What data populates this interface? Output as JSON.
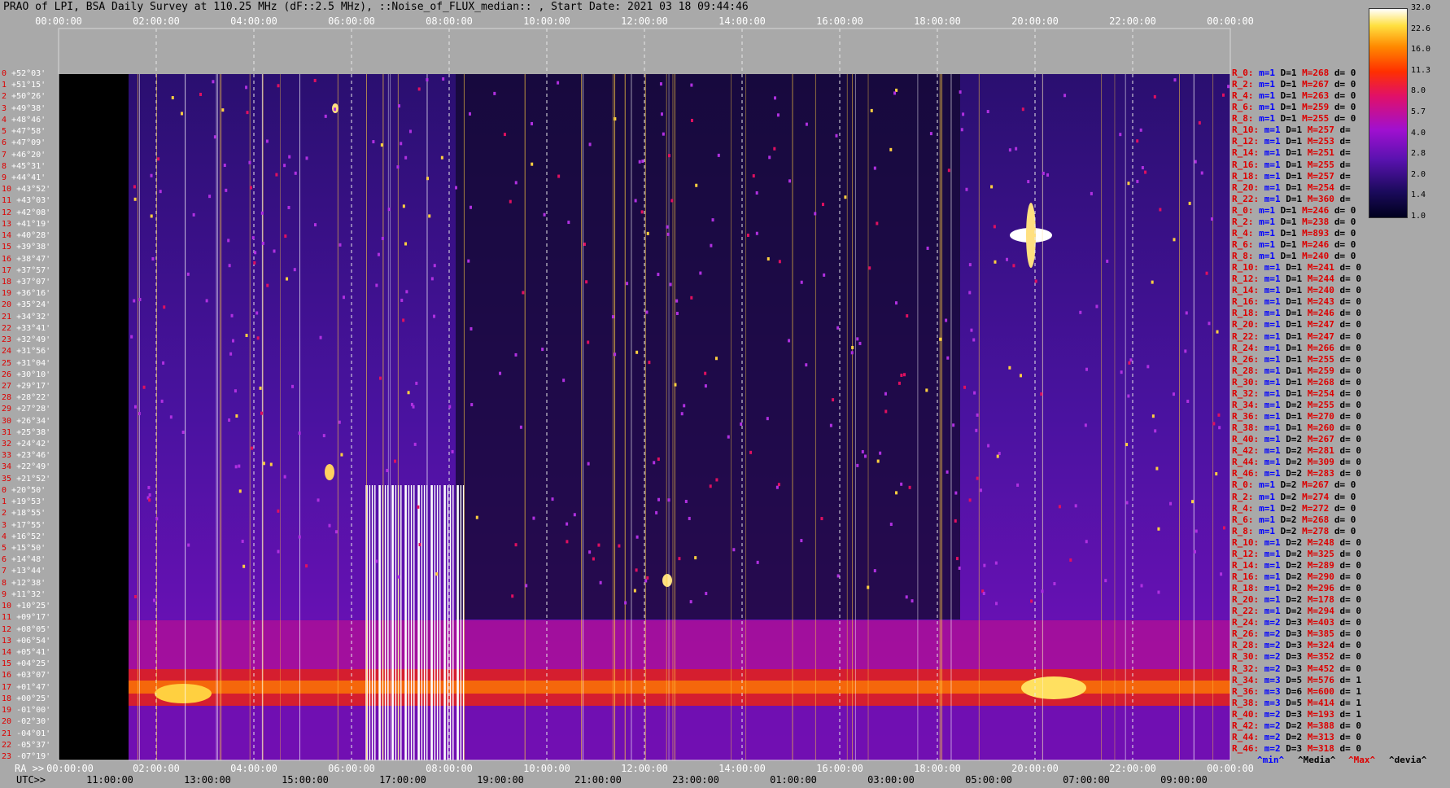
{
  "title": "PRAO of LPI, BSA Daily Survey at 110.25 MHz (dF::2.5 MHz), ::Noise_of_FLUX_median:: , Start Date: 2021 03 18 09:44:46",
  "top_ticks": [
    "00:00:00",
    "02:00:00",
    "04:00:00",
    "06:00:00",
    "08:00:00",
    "10:00:00",
    "12:00:00",
    "14:00:00",
    "16:00:00",
    "18:00:00",
    "20:00:00",
    "22:00:00",
    "00:00:00"
  ],
  "bottom_ra_label": "RA >>",
  "bottom_ra_ticks": [
    "00:00:00",
    "02:00:00",
    "04:00:00",
    "06:00:00",
    "08:00:00",
    "10:00:00",
    "12:00:00",
    "14:00:00",
    "16:00:00",
    "18:00:00",
    "20:00:00",
    "22:00:00",
    "00:00:00"
  ],
  "bottom_utc_label": "UTC>>",
  "bottom_utc_ticks": [
    "11:00:00",
    "13:00:00",
    "15:00:00",
    "17:00:00",
    "19:00:00",
    "21:00:00",
    "23:00:00",
    "01:00:00",
    "03:00:00",
    "05:00:00",
    "07:00:00",
    "09:00:00"
  ],
  "declinations": [
    "+52°03'",
    "+51°15'",
    "+50°26'",
    "+49°38'",
    "+48°46'",
    "+47°58'",
    "+47°09'",
    "+46°20'",
    "+45°31'",
    "+44°41'",
    "+43°52'",
    "+43°03'",
    "+42°08'",
    "+41°19'",
    "+40°28'",
    "+39°38'",
    "+38°47'",
    "+37°57'",
    "+37°07'",
    "+36°16'",
    "+35°24'",
    "+34°32'",
    "+33°41'",
    "+32°49'",
    "+31°56'",
    "+31°04'",
    "+30°10'",
    "+29°17'",
    "+28°22'",
    "+27°28'",
    "+26°34'",
    "+25°38'",
    "+24°42'",
    "+23°46'",
    "+22°49'",
    "+21°52'",
    "+20°50'",
    "+19°53'",
    "+18°55'",
    "+17°55'",
    "+16°52'",
    "+15°50'",
    "+14°48'",
    "+13°44'",
    "+12°38'",
    "+11°32'",
    "+10°25'",
    "+09°17'",
    "+08°05'",
    "+06°54'",
    "+05°41'",
    "+04°25'",
    "+03°07'",
    "+01°47'",
    "+00°25'",
    "-01°00'",
    "-02°30'",
    "-04°01'",
    "-05°37'",
    "-07°19'"
  ],
  "right_rows": [
    {
      "r": "R_0:",
      "m": "m=1",
      "D": "D=1",
      "M": "M=268",
      "d": "d= 0"
    },
    {
      "r": "R_2:",
      "m": "m=1",
      "D": "D=1",
      "M": "M=267",
      "d": "d= 0"
    },
    {
      "r": "R_4:",
      "m": "m=1",
      "D": "D=1",
      "M": "M=263",
      "d": "d= 0"
    },
    {
      "r": "R_6:",
      "m": "m=1",
      "D": "D=1",
      "M": "M=259",
      "d": "d= 0"
    },
    {
      "r": "R_8:",
      "m": "m=1",
      "D": "D=1",
      "M": "M=255",
      "d": "d= 0"
    },
    {
      "r": "R_10:",
      "m": "m=1",
      "D": "D=1",
      "M": "M=257",
      "d": "d="
    },
    {
      "r": "R_12:",
      "m": "m=1",
      "D": "D=1",
      "M": "M=253",
      "d": "d="
    },
    {
      "r": "R_14:",
      "m": "m=1",
      "D": "D=1",
      "M": "M=251",
      "d": "d="
    },
    {
      "r": "R_16:",
      "m": "m=1",
      "D": "D=1",
      "M": "M=255",
      "d": "d="
    },
    {
      "r": "R_18:",
      "m": "m=1",
      "D": "D=1",
      "M": "M=257",
      "d": "d="
    },
    {
      "r": "R_20:",
      "m": "m=1",
      "D": "D=1",
      "M": "M=254",
      "d": "d="
    },
    {
      "r": "R_22:",
      "m": "m=1",
      "D": "D=1",
      "M": "M=360",
      "d": "d="
    },
    {
      "r": "R_0:",
      "m": "m=1",
      "D": "D=1",
      "M": "M=246",
      "d": "d= 0"
    },
    {
      "r": "R_2:",
      "m": "m=1",
      "D": "D=1",
      "M": "M=238",
      "d": "d= 0"
    },
    {
      "r": "R_4:",
      "m": "m=1",
      "D": "D=1",
      "M": "M=893",
      "d": "d= 0"
    },
    {
      "r": "R_6:",
      "m": "m=1",
      "D": "D=1",
      "M": "M=246",
      "d": "d= 0"
    },
    {
      "r": "R_8:",
      "m": "m=1",
      "D": "D=1",
      "M": "M=240",
      "d": "d= 0"
    },
    {
      "r": "R_10:",
      "m": "m=1",
      "D": "D=1",
      "M": "M=241",
      "d": "d= 0"
    },
    {
      "r": "R_12:",
      "m": "m=1",
      "D": "D=1",
      "M": "M=244",
      "d": "d= 0"
    },
    {
      "r": "R_14:",
      "m": "m=1",
      "D": "D=1",
      "M": "M=240",
      "d": "d= 0"
    },
    {
      "r": "R_16:",
      "m": "m=1",
      "D": "D=1",
      "M": "M=243",
      "d": "d= 0"
    },
    {
      "r": "R_18:",
      "m": "m=1",
      "D": "D=1",
      "M": "M=246",
      "d": "d= 0"
    },
    {
      "r": "R_20:",
      "m": "m=1",
      "D": "D=1",
      "M": "M=247",
      "d": "d= 0"
    },
    {
      "r": "R_22:",
      "m": "m=1",
      "D": "D=1",
      "M": "M=247",
      "d": "d= 0"
    },
    {
      "r": "R_24:",
      "m": "m=1",
      "D": "D=1",
      "M": "M=266",
      "d": "d= 0"
    },
    {
      "r": "R_26:",
      "m": "m=1",
      "D": "D=1",
      "M": "M=255",
      "d": "d= 0"
    },
    {
      "r": "R_28:",
      "m": "m=1",
      "D": "D=1",
      "M": "M=259",
      "d": "d= 0"
    },
    {
      "r": "R_30:",
      "m": "m=1",
      "D": "D=1",
      "M": "M=268",
      "d": "d= 0"
    },
    {
      "r": "R_32:",
      "m": "m=1",
      "D": "D=1",
      "M": "M=254",
      "d": "d= 0"
    },
    {
      "r": "R_34:",
      "m": "m=1",
      "D": "D=2",
      "M": "M=255",
      "d": "d= 0"
    },
    {
      "r": "R_36:",
      "m": "m=1",
      "D": "D=1",
      "M": "M=270",
      "d": "d= 0"
    },
    {
      "r": "R_38:",
      "m": "m=1",
      "D": "D=1",
      "M": "M=260",
      "d": "d= 0"
    },
    {
      "r": "R_40:",
      "m": "m=1",
      "D": "D=2",
      "M": "M=267",
      "d": "d= 0"
    },
    {
      "r": "R_42:",
      "m": "m=1",
      "D": "D=2",
      "M": "M=281",
      "d": "d= 0"
    },
    {
      "r": "R_44:",
      "m": "m=1",
      "D": "D=2",
      "M": "M=309",
      "d": "d= 0"
    },
    {
      "r": "R_46:",
      "m": "m=1",
      "D": "D=2",
      "M": "M=283",
      "d": "d= 0"
    },
    {
      "r": "R_0:",
      "m": "m=1",
      "D": "D=2",
      "M": "M=267",
      "d": "d= 0"
    },
    {
      "r": "R_2:",
      "m": "m=1",
      "D": "D=2",
      "M": "M=274",
      "d": "d= 0"
    },
    {
      "r": "R_4:",
      "m": "m=1",
      "D": "D=2",
      "M": "M=272",
      "d": "d= 0"
    },
    {
      "r": "R_6:",
      "m": "m=1",
      "D": "D=2",
      "M": "M=268",
      "d": "d= 0"
    },
    {
      "r": "R_8:",
      "m": "m=1",
      "D": "D=2",
      "M": "M=278",
      "d": "d= 0"
    },
    {
      "r": "R_10:",
      "m": "m=1",
      "D": "D=2",
      "M": "M=248",
      "d": "d= 0"
    },
    {
      "r": "R_12:",
      "m": "m=1",
      "D": "D=2",
      "M": "M=325",
      "d": "d= 0"
    },
    {
      "r": "R_14:",
      "m": "m=1",
      "D": "D=2",
      "M": "M=289",
      "d": "d= 0"
    },
    {
      "r": "R_16:",
      "m": "m=1",
      "D": "D=2",
      "M": "M=290",
      "d": "d= 0"
    },
    {
      "r": "R_18:",
      "m": "m=1",
      "D": "D=2",
      "M": "M=296",
      "d": "d= 0"
    },
    {
      "r": "R_20:",
      "m": "m=1",
      "D": "D=2",
      "M": "M=178",
      "d": "d= 0"
    },
    {
      "r": "R_22:",
      "m": "m=1",
      "D": "D=2",
      "M": "M=294",
      "d": "d= 0"
    },
    {
      "r": "R_24:",
      "m": "m=2",
      "D": "D=3",
      "M": "M=403",
      "d": "d= 0"
    },
    {
      "r": "R_26:",
      "m": "m=2",
      "D": "D=3",
      "M": "M=385",
      "d": "d= 0"
    },
    {
      "r": "R_28:",
      "m": "m=2",
      "D": "D=3",
      "M": "M=324",
      "d": "d= 0"
    },
    {
      "r": "R_30:",
      "m": "m=2",
      "D": "D=3",
      "M": "M=352",
      "d": "d= 0"
    },
    {
      "r": "R_32:",
      "m": "m=2",
      "D": "D=3",
      "M": "M=452",
      "d": "d= 0"
    },
    {
      "r": "R_34:",
      "m": "m=3",
      "D": "D=5",
      "M": "M=576",
      "d": "d= 1"
    },
    {
      "r": "R_36:",
      "m": "m=3",
      "D": "D=6",
      "M": "M=600",
      "d": "d= 1"
    },
    {
      "r": "R_38:",
      "m": "m=3",
      "D": "D=5",
      "M": "M=414",
      "d": "d= 1"
    },
    {
      "r": "R_40:",
      "m": "m=2",
      "D": "D=3",
      "M": "M=193",
      "d": "d= 1"
    },
    {
      "r": "R_42:",
      "m": "m=2",
      "D": "D=2",
      "M": "M=388",
      "d": "d= 0"
    },
    {
      "r": "R_44:",
      "m": "m=2",
      "D": "D=2",
      "M": "M=313",
      "d": "d= 0"
    },
    {
      "r": "R_46:",
      "m": "m=2",
      "D": "D=3",
      "M": "M=318",
      "d": "d= 0"
    }
  ],
  "legend": {
    "min": "^min^",
    "media": "^Media^",
    "max": "^Max^",
    "devia": "^devia^"
  },
  "colorbar": {
    "labels": [
      "32.0",
      "22.6",
      "16.0",
      "11.3",
      "8.0",
      "5.7",
      "4.0",
      "2.8",
      "2.0",
      "1.4",
      "1.0"
    ]
  },
  "colors": {
    "low": "#00001e",
    "mid": "#a010d0",
    "high": "#ff3000",
    "peak": "#ffffff"
  },
  "chart_data": {
    "type": "heatmap",
    "title": "PRAO of LPI, BSA Daily Survey at 110.25 MHz (dF::2.5 MHz), ::Noise_of_FLUX_median:: , Start Date: 2021 03 18 09:44:46",
    "x_axis_top": "RA 00:00:00 – 00:00:00 (24 h)",
    "x_axis_bottom": "UTC 11:00:00 – 09:00:00",
    "y_axis": "Declination +52°03' to -07°19'",
    "colorscale_range": [
      1.0,
      32.0
    ],
    "colorscale_ticks": [
      32.0,
      22.6,
      16.0,
      11.3,
      8.0,
      5.7,
      4.0,
      2.8,
      2.0,
      1.4,
      1.0
    ]
  }
}
